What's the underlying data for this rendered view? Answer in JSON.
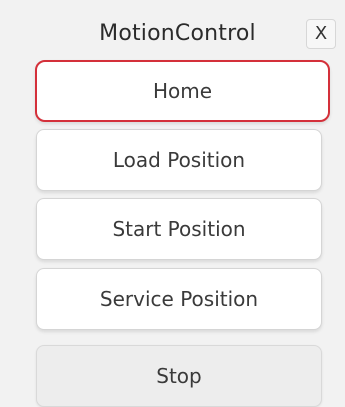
{
  "window": {
    "title": "MotionControl",
    "close_label": "X"
  },
  "buttons": {
    "home": "Home",
    "load_position": "Load Position",
    "start_position": "Start Position",
    "service_position": "Service Position",
    "stop": "Stop"
  },
  "colors": {
    "selected_border": "#d4303a",
    "background": "#f2f2f2"
  }
}
